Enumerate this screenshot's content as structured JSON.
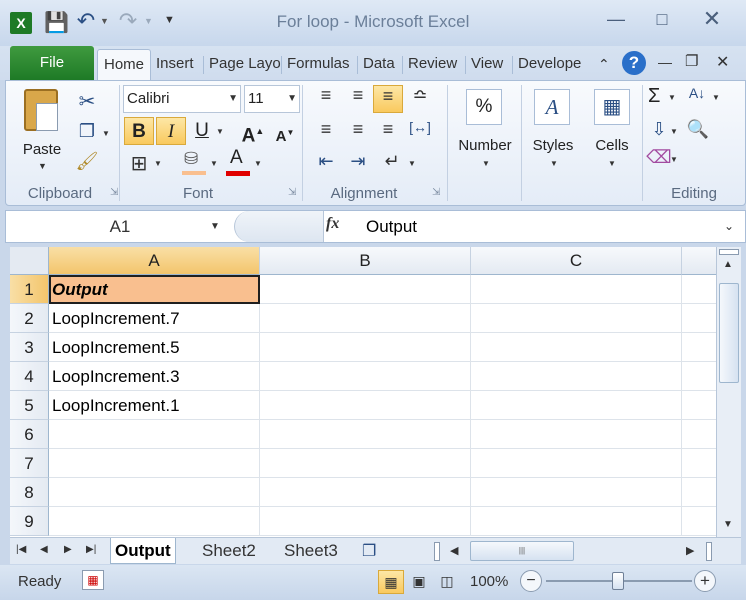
{
  "window": {
    "title": "For loop  -  Microsoft Excel",
    "qat": {
      "save_icon": "save-icon",
      "undo_icon": "undo-icon",
      "redo_icon": "redo-icon"
    }
  },
  "tabs": [
    {
      "label": "File"
    },
    {
      "label": "Home"
    },
    {
      "label": "Insert"
    },
    {
      "label": "Page Layo"
    },
    {
      "label": "Formulas"
    },
    {
      "label": "Data"
    },
    {
      "label": "Review"
    },
    {
      "label": "View"
    },
    {
      "label": "Develope"
    }
  ],
  "ribbon": {
    "clipboard": {
      "label": "Clipboard",
      "paste": "Paste"
    },
    "font": {
      "label": "Font",
      "name": "Calibri",
      "size": "11",
      "bold": "B",
      "italic": "I",
      "underline": "U",
      "font_color": "#e00000"
    },
    "alignment": {
      "label": "Alignment"
    },
    "number": {
      "label": "Number",
      "symbol": "%"
    },
    "styles": {
      "label": "Styles"
    },
    "cells": {
      "label": "Cells"
    },
    "editing": {
      "label": "Editing",
      "sigma": "Σ"
    }
  },
  "formula_bar": {
    "name_box": "A1",
    "fx": "fx",
    "content": "Output"
  },
  "columns": [
    "A",
    "B",
    "C"
  ],
  "rows": [
    "1",
    "2",
    "3",
    "4",
    "5",
    "6",
    "7",
    "8",
    "9"
  ],
  "cells_a": [
    "Output",
    "LoopIncrement.7",
    "LoopIncrement.5",
    "LoopIncrement.3",
    "LoopIncrement.1",
    "",
    "",
    "",
    ""
  ],
  "header_fill": "#f9bf8f",
  "sheets": [
    {
      "label": "Output"
    },
    {
      "label": "Sheet2"
    },
    {
      "label": "Sheet3"
    }
  ],
  "status": {
    "ready": "Ready",
    "zoom": "100%",
    "zoom_minus": "−",
    "zoom_plus": "+"
  }
}
